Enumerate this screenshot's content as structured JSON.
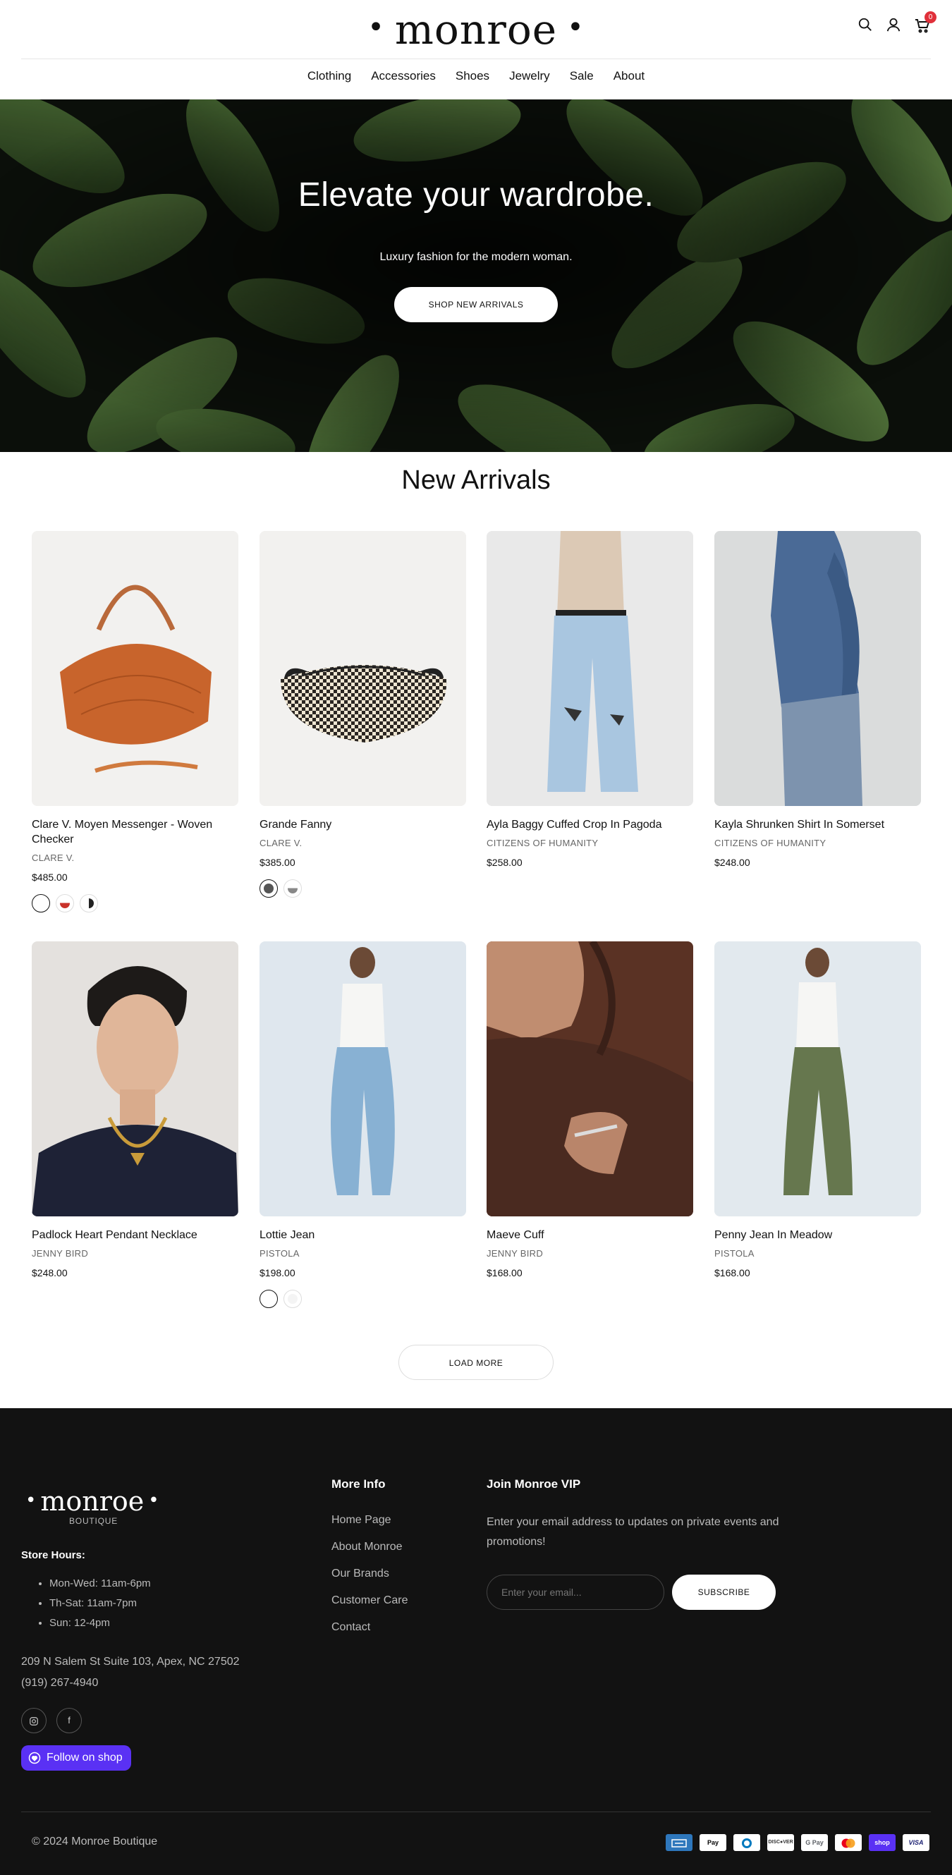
{
  "brand": {
    "logo": "monroe",
    "footer_logo": "monroe",
    "footer_sub": "BOUTIQUE"
  },
  "header": {
    "cart_count": "0"
  },
  "nav": [
    "Clothing",
    "Accessories",
    "Shoes",
    "Jewelry",
    "Sale",
    "About"
  ],
  "hero": {
    "title": "Elevate your wardrobe.",
    "subtitle": "Luxury fashion for the modern woman.",
    "button": "SHOP NEW ARRIVALS"
  },
  "section": {
    "title": "New Arrivals",
    "load_more": "LOAD MORE"
  },
  "products": [
    {
      "name": "Clare V. Moyen Messenger - Woven Checker",
      "brand": "CLARE V.",
      "price": "$485.00"
    },
    {
      "name": "Grande Fanny",
      "brand": "CLARE V.",
      "price": "$385.00"
    },
    {
      "name": "Ayla Baggy Cuffed Crop In Pagoda",
      "brand": "CITIZENS OF HUMANITY",
      "price": "$258.00"
    },
    {
      "name": "Kayla Shrunken Shirt In Somerset",
      "brand": "CITIZENS OF HUMANITY",
      "price": "$248.00"
    },
    {
      "name": "Padlock Heart Pendant Necklace",
      "brand": "JENNY BIRD",
      "price": "$248.00"
    },
    {
      "name": "Lottie Jean",
      "brand": "PISTOLA",
      "price": "$198.00"
    },
    {
      "name": "Maeve Cuff",
      "brand": "JENNY BIRD",
      "price": "$168.00"
    },
    {
      "name": "Penny Jean In Meadow",
      "brand": "PISTOLA",
      "price": "$168.00"
    }
  ],
  "footer": {
    "hours_title": "Store Hours:",
    "hours": [
      "Mon-Wed: 11am-6pm",
      "Th-Sat: 11am-7pm",
      "Sun: 12-4pm"
    ],
    "address": "209 N Salem St Suite 103, Apex, NC 27502",
    "phone": "(919) 267-4940",
    "follow": "Follow on shop",
    "more_title": "More Info",
    "more_links": [
      "Home Page",
      "About Monroe",
      "Our Brands",
      "Customer Care",
      "Contact"
    ],
    "vip_title": "Join Monroe VIP",
    "vip_text": "Enter your email address to updates on private events and promotions!",
    "email_placeholder": "Enter your email...",
    "subscribe": "SUBSCRIBE",
    "copyright": "© 2024 Monroe Boutique",
    "payments": [
      "American Express",
      "Apple Pay",
      "Diners Club",
      "Discover",
      "Google Pay",
      "Mastercard",
      "Shop Pay",
      "Visa"
    ]
  },
  "colors": {
    "accent": "#5a31f4",
    "badge": "#e0303a",
    "footer_bg": "#121212",
    "hero_bg": "#0b0f0a"
  }
}
